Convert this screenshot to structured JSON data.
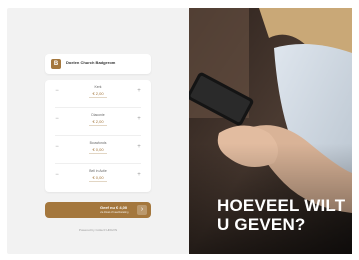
{
  "header": {
    "logo_letter": "B",
    "church_name": "Doelen Church Badgerom"
  },
  "items": [
    {
      "label": "Kerk",
      "value": "€ 2,00",
      "minus": "−",
      "plus": "+"
    },
    {
      "label": "Diaconie",
      "value": "€ 2,00",
      "minus": "−",
      "plus": "+"
    },
    {
      "label": "Bouwfonds",
      "value": "€ 0,00",
      "minus": "−",
      "plus": "+"
    },
    {
      "label": "Bell in Actie",
      "value": "€ 0,00",
      "minus": "−",
      "plus": "+"
    }
  ],
  "give_button": {
    "label": "Geef nu € 4,00",
    "sublabel": "via iDeal of kaartbetaling",
    "arrow": "›"
  },
  "footer": {
    "powered_by": "Powered by Collect! HDGVN"
  },
  "hero": {
    "headline_line1": "HOEVEEL WILT",
    "headline_line2": "U GEVEN?"
  },
  "colors": {
    "accent": "#a4773d",
    "panel_bg": "#f2f2f2"
  },
  "icons": {
    "minus": "minus-icon",
    "plus": "plus-icon",
    "arrow": "arrow-right-icon"
  }
}
